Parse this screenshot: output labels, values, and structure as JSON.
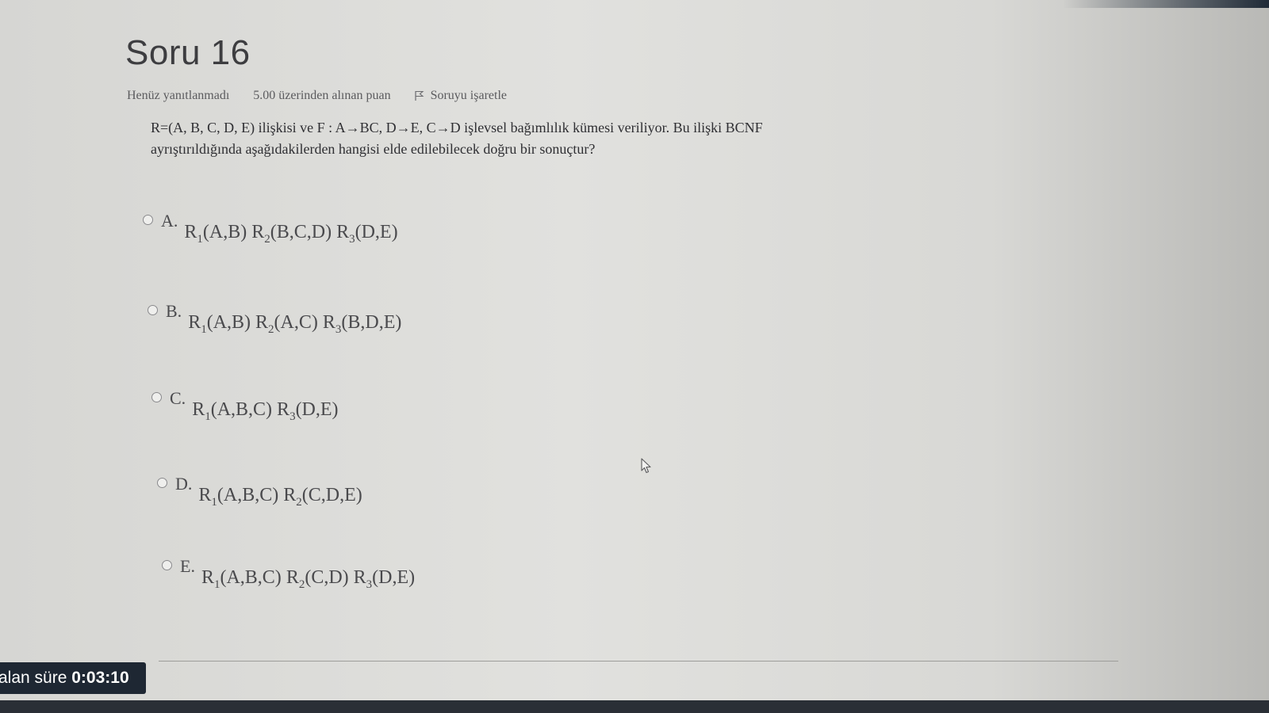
{
  "question": {
    "title": "Soru 16",
    "status": "Henüz yanıtlanmadı",
    "grade": "5.00 üzerinden alınan puan",
    "flag_label": "Soruyu işaretle",
    "text": "R=(A, B, C, D, E) ilişkisi ve F : A→BC, D→E, C→D işlevsel bağımlılık kümesi veriliyor. Bu ilişki BCNF ayrıştırıldığında aşağıdakilerden hangisi elde edilebilecek doğru bir sonuçtur?"
  },
  "answers": [
    {
      "letter": "A.",
      "parts": [
        [
          "R",
          "1",
          "(A,B)"
        ],
        [
          "R",
          "2",
          "(B,C,D)"
        ],
        [
          "R",
          "3",
          "(D,E)"
        ]
      ]
    },
    {
      "letter": "B.",
      "parts": [
        [
          "R",
          "1",
          "(A,B)"
        ],
        [
          "R",
          "2",
          "(A,C)"
        ],
        [
          "R",
          "3",
          "(B,D,E)"
        ]
      ]
    },
    {
      "letter": "C.",
      "parts": [
        [
          "R",
          "1",
          "(A,B,C)"
        ],
        [
          "R",
          "3",
          "(D,E)"
        ]
      ]
    },
    {
      "letter": "D.",
      "parts": [
        [
          "R",
          "1",
          "(A,B,C)"
        ],
        [
          "R",
          "2",
          "(C,D,E)"
        ]
      ]
    },
    {
      "letter": "E.",
      "parts": [
        [
          "R",
          "1",
          "(A,B,C)"
        ],
        [
          "R",
          "2",
          "(C,D)"
        ],
        [
          "R",
          "3",
          "(D,E)"
        ]
      ]
    }
  ],
  "timer": {
    "label": "alan süre",
    "value": "0:03:10"
  },
  "icons": {
    "flag": "flag-icon",
    "radio": "radio-icon",
    "cursor": "mouse-cursor-icon"
  }
}
